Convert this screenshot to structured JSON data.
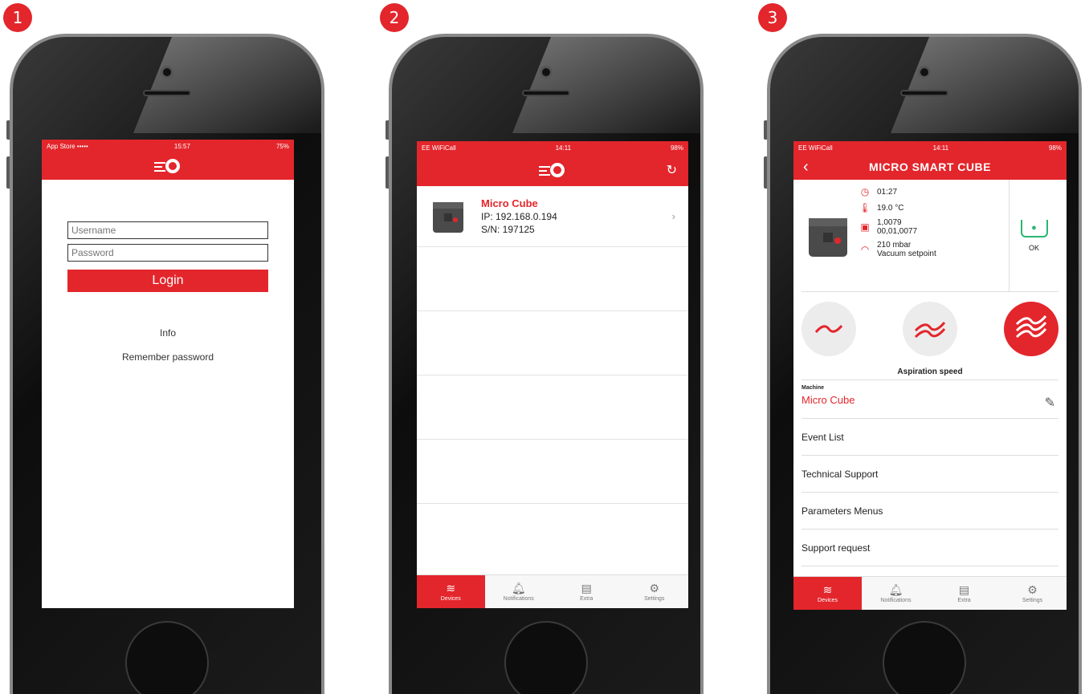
{
  "badges": [
    "1",
    "2",
    "3"
  ],
  "colors": {
    "brand_red": "#e3262c",
    "status_green": "#2bb673"
  },
  "screen1": {
    "status": {
      "left": "App Store ••••• ",
      "time": "15:57",
      "right": "75%"
    },
    "logo_icon": "app-logo-icon",
    "username_placeholder": "Username",
    "password_placeholder": "Password",
    "login_label": "Login",
    "info_label": "Info",
    "remember_label": "Remember password"
  },
  "screen2": {
    "status": {
      "left": "EE WiFiCall",
      "time": "14:11",
      "right": "98%"
    },
    "refresh_icon": "refresh-icon",
    "device": {
      "name": "Micro Cube",
      "ip": "IP: 192.168.0.194",
      "sn": "S/N: 197125"
    },
    "tabs": [
      "Devices",
      "Notifications",
      "Extra",
      "Settings"
    ]
  },
  "screen3": {
    "status": {
      "left": "EE WiFiCall",
      "time": "14:11",
      "right": "98%"
    },
    "title": "MICRO SMART CUBE",
    "time_value": "01:27",
    "temp_value": "19.0 °C",
    "counter_line1": "1,0079",
    "counter_line2": "00,01,0077",
    "vacuum_value": "210 mbar",
    "vacuum_label": "Vacuum setpoint",
    "tank_status": "OK",
    "speed_label": "Aspiration speed",
    "speed_selected_level": 3,
    "machine_caption": "Machine",
    "machine_name": "Micro Cube",
    "menu": [
      "Event List",
      "Technical Support",
      "Parameters Menus",
      "Support request"
    ],
    "tabs": [
      "Devices",
      "Notifications",
      "Extra",
      "Settings"
    ]
  }
}
